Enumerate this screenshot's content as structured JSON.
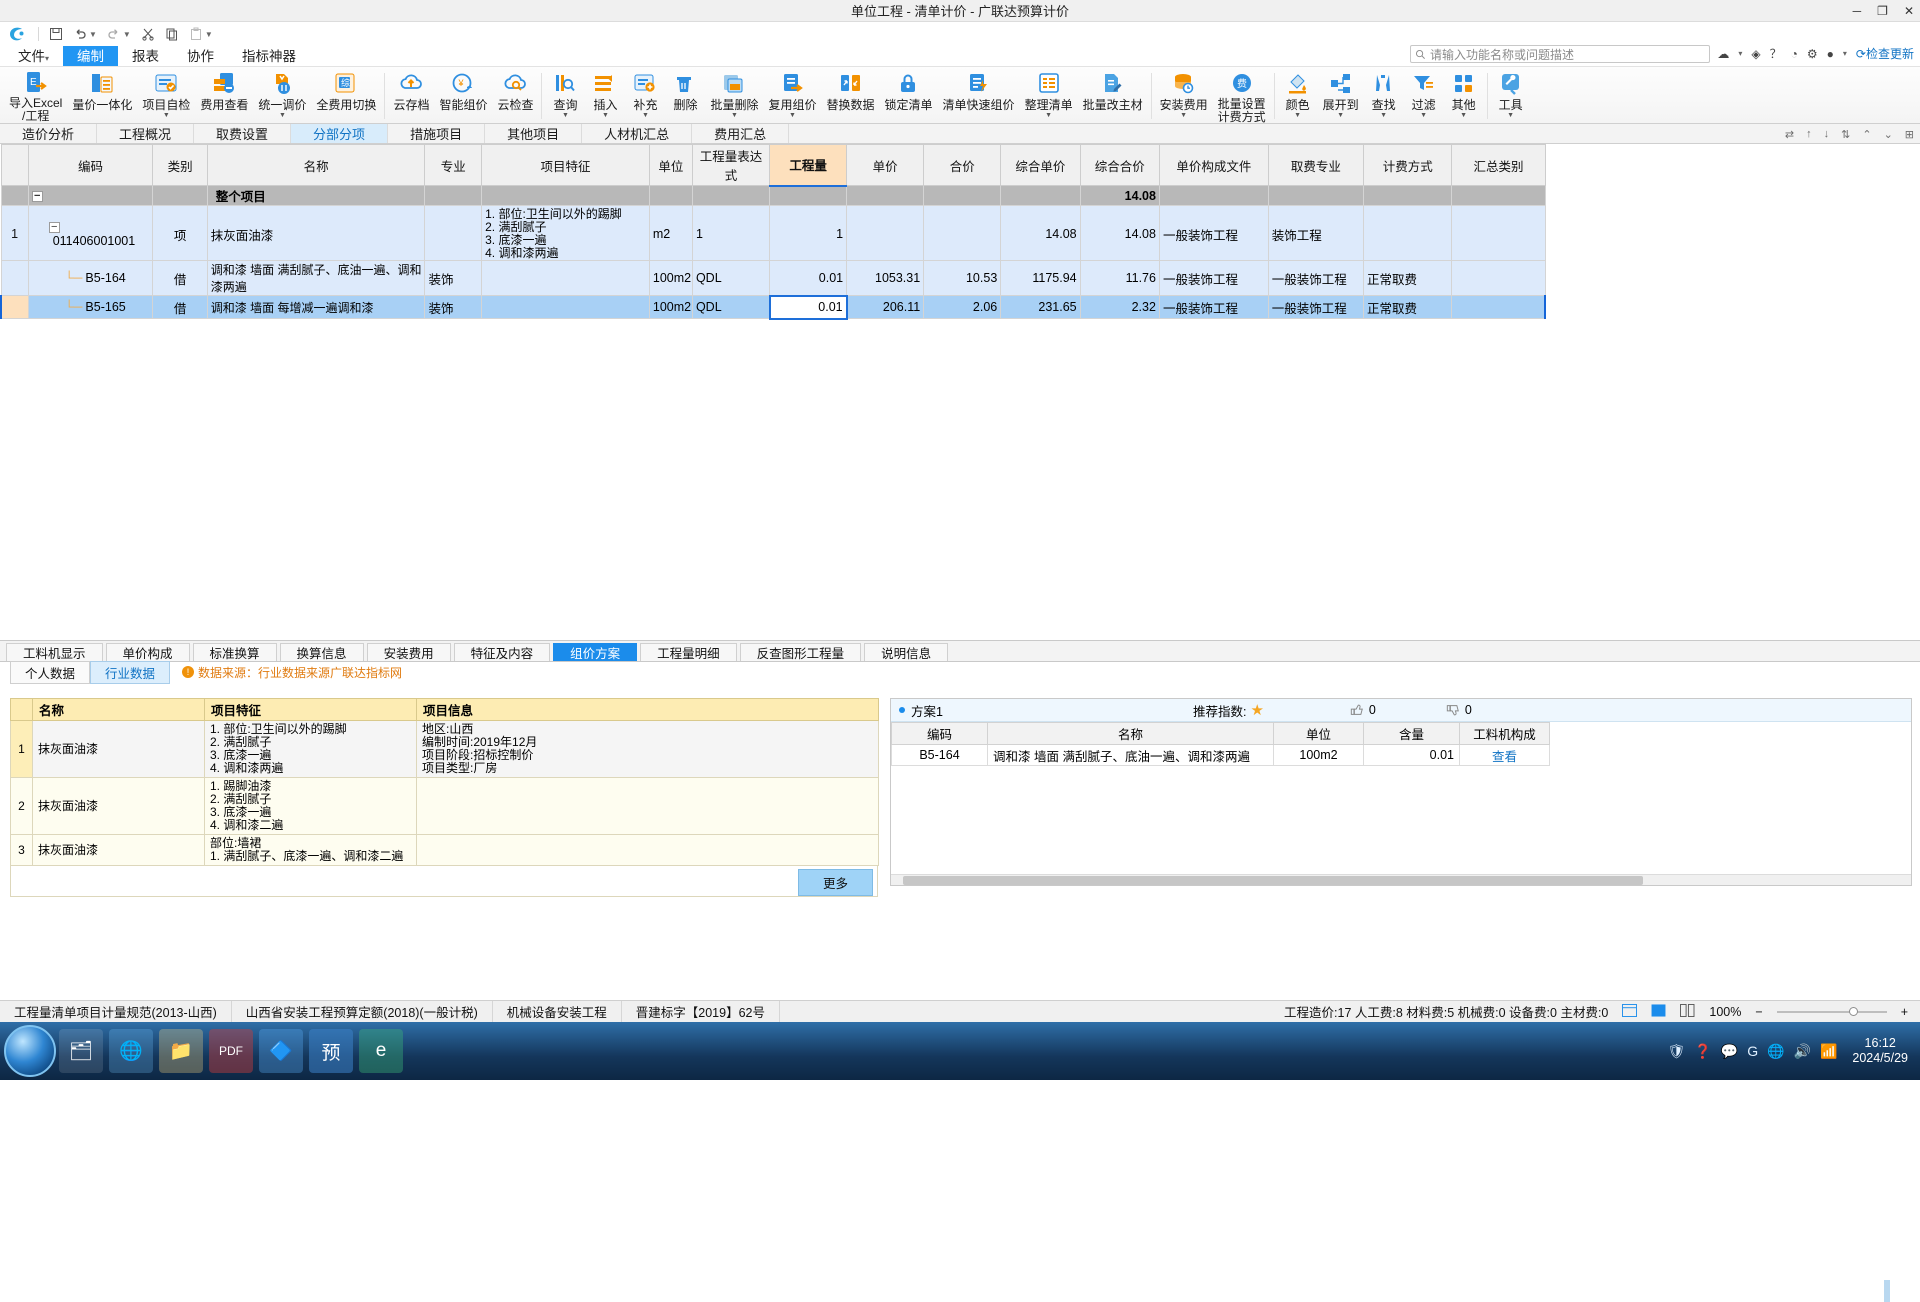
{
  "window": {
    "title": "单位工程 - 清单计价 - 广联达预算计价",
    "buttons": [
      "─",
      "❐",
      "✕"
    ]
  },
  "quick_access": {
    "items": [
      {
        "name": "save",
        "glyph": "🖫"
      },
      {
        "name": "undo",
        "glyph": "↺"
      },
      {
        "name": "redo",
        "glyph": "↻"
      },
      {
        "name": "cut",
        "glyph": "✂"
      },
      {
        "name": "copy",
        "glyph": "❐"
      },
      {
        "name": "paste",
        "glyph": "📋"
      }
    ]
  },
  "menu": {
    "items": [
      {
        "label": "文件",
        "caret": true,
        "active": false
      },
      {
        "label": "编制",
        "caret": false,
        "active": true
      },
      {
        "label": "报表",
        "caret": false,
        "active": false
      },
      {
        "label": "协作",
        "caret": false,
        "active": false
      },
      {
        "label": "指标神器",
        "caret": false,
        "active": false
      }
    ]
  },
  "search": {
    "placeholder": "请输入功能名称或问题描述",
    "icon": "search-icon"
  },
  "top_right": {
    "items": [
      "☁",
      "◈",
      "？",
      "◔",
      "⚙",
      "●"
    ],
    "update_label": "检查更新",
    "update_icon": "refresh-icon"
  },
  "ribbon": {
    "groups": [
      {
        "items": [
          {
            "label": "导入Excel\n/工程",
            "icon": "excel-import-icon",
            "dropdown": true
          },
          {
            "label": "量价一体化",
            "icon": "quantity-price-icon",
            "dropdown": false
          },
          {
            "label": "项目自检",
            "icon": "self-check-icon",
            "dropdown": true
          },
          {
            "label": "费用查看",
            "icon": "fee-view-icon",
            "dropdown": false
          },
          {
            "label": "统一调价",
            "icon": "unified-price-icon",
            "dropdown": true
          },
          {
            "label": "全费用切换",
            "icon": "full-fee-switch-icon",
            "dropdown": false
          }
        ]
      },
      {
        "items": [
          {
            "label": "云存档",
            "icon": "cloud-archive-icon",
            "dropdown": false
          },
          {
            "label": "智能组价",
            "icon": "smart-pricing-icon",
            "dropdown": false
          },
          {
            "label": "云检查",
            "icon": "cloud-check-icon",
            "dropdown": false
          }
        ]
      },
      {
        "items": [
          {
            "label": "查询",
            "icon": "query-icon",
            "dropdown": true
          },
          {
            "label": "插入",
            "icon": "insert-icon",
            "dropdown": true
          },
          {
            "label": "补充",
            "icon": "supplement-icon",
            "dropdown": true
          },
          {
            "label": "删除",
            "icon": "delete-icon",
            "dropdown": false
          },
          {
            "label": "批量删除",
            "icon": "batch-delete-icon",
            "dropdown": true
          },
          {
            "label": "复用组价",
            "icon": "reuse-pricing-icon",
            "dropdown": true
          },
          {
            "label": "替换数据",
            "icon": "replace-data-icon",
            "dropdown": false
          },
          {
            "label": "锁定清单",
            "icon": "lock-list-icon",
            "dropdown": false
          },
          {
            "label": "清单快速组价",
            "icon": "quick-pricing-icon",
            "dropdown": false
          },
          {
            "label": "整理清单",
            "icon": "organize-list-icon",
            "dropdown": true
          },
          {
            "label": "批量改主材",
            "icon": "batch-material-icon",
            "dropdown": false
          }
        ]
      },
      {
        "items": [
          {
            "label": "安装费用",
            "icon": "install-fee-icon",
            "dropdown": true
          },
          {
            "label": "批量设置\n计费方式",
            "icon": "batch-fee-icon",
            "dropdown": false
          }
        ]
      },
      {
        "items": [
          {
            "label": "颜色",
            "icon": "color-icon",
            "dropdown": true
          },
          {
            "label": "展开到",
            "icon": "expand-to-icon",
            "dropdown": true
          },
          {
            "label": "查找",
            "icon": "find-icon",
            "dropdown": true
          },
          {
            "label": "过滤",
            "icon": "filter-icon",
            "dropdown": true
          },
          {
            "label": "其他",
            "icon": "other-icon",
            "dropdown": true
          }
        ]
      },
      {
        "items": [
          {
            "label": "工具",
            "icon": "tools-icon",
            "dropdown": true
          }
        ]
      }
    ]
  },
  "module_tabs": {
    "items": [
      "造价分析",
      "工程概况",
      "取费设置",
      "分部分项",
      "措施项目",
      "其他项目",
      "人材机汇总",
      "费用汇总"
    ],
    "active": "分部分项",
    "right_tools": [
      "⇄",
      "↑",
      "↓",
      "⇅",
      "⌃",
      "⌄",
      "⊞"
    ]
  },
  "grid": {
    "columns": [
      "",
      "编码",
      "类别",
      "名称",
      "专业",
      "项目特征",
      "单位",
      "工程量表达式",
      "工程量",
      "单价",
      "合价",
      "综合单价",
      "综合合价",
      "单价构成文件",
      "取费专业",
      "计费方式",
      "汇总类别"
    ],
    "selected_column": "工程量",
    "rows": [
      {
        "type": "total",
        "no": "",
        "tree": "−",
        "code": "",
        "category": "",
        "name": "整个项目",
        "specialty": "",
        "feature": "",
        "unit": "",
        "expr": "",
        "qty": "",
        "price": "",
        "amount": "",
        "comp_price": "",
        "comp_amount": "14.08",
        "price_file": "",
        "fee_specialty": "",
        "fee_mode": "",
        "sum_type": ""
      },
      {
        "type": "item",
        "no": "1",
        "tree": "−",
        "code": "011406001001",
        "category": "项",
        "name": "抹灰面油漆",
        "specialty": "",
        "feature": "1. 部位:卫生间以外的踢脚\n2. 满刮腻子\n3. 底漆一遍\n4. 调和漆两遍",
        "unit": "m2",
        "expr": "1",
        "qty": "1",
        "price": "",
        "amount": "",
        "comp_price": "14.08",
        "comp_amount": "14.08",
        "price_file": "一般装饰工程",
        "fee_specialty": "装饰工程",
        "fee_mode": "",
        "sum_type": ""
      },
      {
        "type": "sub",
        "no": "",
        "tree": "",
        "code": "B5-164",
        "category": "借",
        "name": "调和漆 墙面 满刮腻子、底油一遍、调和漆两遍",
        "specialty": "装饰",
        "feature": "",
        "unit": "100m2",
        "expr": "QDL",
        "qty": "0.01",
        "price": "1053.31",
        "amount": "10.53",
        "comp_price": "1175.94",
        "comp_amount": "11.76",
        "price_file": "一般装饰工程",
        "fee_specialty": "一般装饰工程",
        "fee_mode": "正常取费",
        "sum_type": ""
      },
      {
        "type": "sub-selected",
        "no": "",
        "tree": "",
        "code": "B5-165",
        "category": "借",
        "name": "调和漆 墙面 每增减一遍调和漆",
        "specialty": "装饰",
        "feature": "",
        "unit": "100m2",
        "expr": "QDL",
        "qty": "0.01",
        "price": "206.11",
        "amount": "2.06",
        "comp_price": "231.65",
        "comp_amount": "2.32",
        "price_file": "一般装饰工程",
        "fee_specialty": "一般装饰工程",
        "fee_mode": "正常取费",
        "sum_type": ""
      }
    ]
  },
  "bottom": {
    "tabs": [
      "工料机显示",
      "单价构成",
      "标准换算",
      "换算信息",
      "安装费用",
      "特征及内容",
      "组价方案",
      "工程量明细",
      "反查图形工程量",
      "说明信息"
    ],
    "active_tab": "组价方案",
    "sub_tabs": [
      "个人数据",
      "行业数据"
    ],
    "active_sub_tab": "行业数据",
    "source_note": "数据来源：行业数据来源广联达指标网",
    "left_table": {
      "columns": [
        "",
        "名称",
        "项目特征",
        "项目信息"
      ],
      "rows": [
        {
          "no": "1",
          "name": "抹灰面油漆",
          "feature": "1. 部位:卫生间以外的踢脚\n2. 满刮腻子\n3. 底漆一遍\n4. 调和漆两遍",
          "info": "地区:山西\n编制时间:2019年12月\n项目阶段:招标控制价\n项目类型:厂房",
          "selected": true
        },
        {
          "no": "2",
          "name": "抹灰面油漆",
          "feature": "1. 踢脚油漆\n2. 满刮腻子\n3. 底漆一遍\n4. 调和漆二遍",
          "info": "",
          "selected": false
        },
        {
          "no": "3",
          "name": "抹灰面油漆",
          "feature": "部位:墙裙\n1. 满刮腻子、底漆一遍、调和漆二遍",
          "info": "",
          "selected": false
        }
      ],
      "more_button": "更多"
    },
    "right_panel": {
      "scheme_label": "方案1",
      "recommend_label": "推荐指数:",
      "recommend_star": "★",
      "thumb_up_icon": "thumbs-up-icon",
      "thumb_up_count": "0",
      "thumb_down_icon": "thumbs-down-icon",
      "thumb_down_count": "0",
      "columns": [
        "编码",
        "名称",
        "单位",
        "含量",
        "工料机构成"
      ],
      "rows": [
        {
          "code": "B5-164",
          "name": "调和漆 墙面 满刮腻子、底油一遍、调和漆两遍",
          "unit": "100m2",
          "content": "0.01",
          "action": "查看"
        }
      ]
    }
  },
  "status_bar": {
    "left_segments": [
      "工程量清单项目计量规范(2013-山西)",
      "山西省安装工程预算定额(2018)(一般计税)",
      "机械设备安装工程",
      "晋建标字【2019】62号"
    ],
    "counts": "工程造价:17  人工费:8  材料费:5  机械费:0  设备费:0  主材费:0",
    "view_icons": [
      "grid-view-icon",
      "page-view-icon",
      "split-view-icon"
    ],
    "zoom": "100%",
    "zoom_minus": "−",
    "zoom_plus": "+"
  },
  "taskbar": {
    "items": [
      {
        "name": "start-orb",
        "glyph": ""
      },
      {
        "name": "explorer-icon",
        "glyph": "🗂"
      },
      {
        "name": "browser-icon",
        "glyph": "🌐"
      },
      {
        "name": "folder-icon",
        "glyph": "📁"
      },
      {
        "name": "pdf-icon",
        "glyph": "PDF"
      },
      {
        "name": "app-icon",
        "glyph": "🔷"
      },
      {
        "name": "glodon-icon",
        "glyph": "预"
      },
      {
        "name": "edge-icon",
        "glyph": "e"
      }
    ],
    "tray": [
      "🛡",
      "❓",
      "💬",
      "G",
      "🌐",
      "🔊",
      "📶"
    ],
    "time": "16:12",
    "date": "2024/5/29"
  },
  "colors": {
    "accent": "#1b8ceb",
    "selected_row": "#a8d0f5",
    "item_row": "#ddeafb",
    "total_row": "#b8b8b8",
    "selected_col_header": "#fde0bd",
    "yellow_table": "#fdecb3"
  }
}
